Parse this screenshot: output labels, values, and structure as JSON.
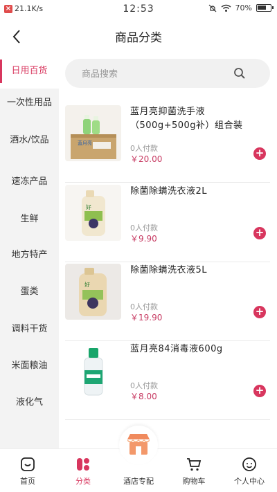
{
  "status_bar": {
    "speed": "21.1K/s",
    "time": "12:53",
    "battery": "70%"
  },
  "header": {
    "title": "商品分类"
  },
  "search": {
    "placeholder": "商品搜索"
  },
  "sidebar": {
    "items": [
      {
        "label": "日用百货",
        "active": true
      },
      {
        "label": "一次性用品"
      },
      {
        "label": "酒水/饮品"
      },
      {
        "label": "速冻产品"
      },
      {
        "label": "生鲜"
      },
      {
        "label": "地方特产"
      },
      {
        "label": "蛋类"
      },
      {
        "label": "调料干货"
      },
      {
        "label": "米面粮油"
      },
      {
        "label": "液化气"
      }
    ]
  },
  "products": [
    {
      "name": "蓝月亮抑菌洗手液（500g+500g补）组合装",
      "sold": "0人付款",
      "price": "￥20.00"
    },
    {
      "name": "除菌除螨洗衣液2L",
      "sold": "0人付款",
      "price": "￥9.90"
    },
    {
      "name": "除菌除螨洗衣液5L",
      "sold": "0人付款",
      "price": "￥19.90"
    },
    {
      "name": "蓝月亮84消毒液600g",
      "sold": "0人付款",
      "price": "￥8.00"
    }
  ],
  "bottom_nav": {
    "items": [
      {
        "label": "首页",
        "icon": "home-icon"
      },
      {
        "label": "分类",
        "icon": "category-icon",
        "active": true
      },
      {
        "label": "酒店专配",
        "icon": "shop-icon"
      },
      {
        "label": "购物车",
        "icon": "cart-icon"
      },
      {
        "label": "个人中心",
        "icon": "user-icon"
      }
    ]
  },
  "colors": {
    "accent": "#d8365e",
    "sidebar_bg": "#f3f3f3",
    "search_bg": "#f1f1f1",
    "price": "#c73a62"
  }
}
